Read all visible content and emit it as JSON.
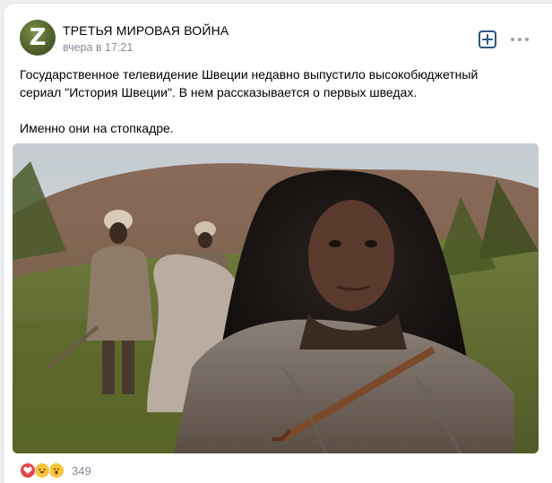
{
  "post": {
    "author": "ТРЕТЬЯ МИРОВАЯ ВОЙНА",
    "avatar_letter": "Z",
    "time": "вчера в 17:21",
    "text_line1": "Государственное телевидение Швеции недавно выпустило высокобюджетный",
    "text_line2": "сериал \"История Швеции\". В нем рассказывается о первых шведах.",
    "text_line3": "Именно они на стопкадре.",
    "reactions_count": "349",
    "reaction_icons": [
      "heart-icon",
      "laughing-face-icon",
      "surprised-face-icon"
    ],
    "colors": {
      "link": "#2a5885",
      "secondary_text": "#818c99",
      "heart": "#e64646",
      "emoji": "#f9c43b"
    }
  }
}
